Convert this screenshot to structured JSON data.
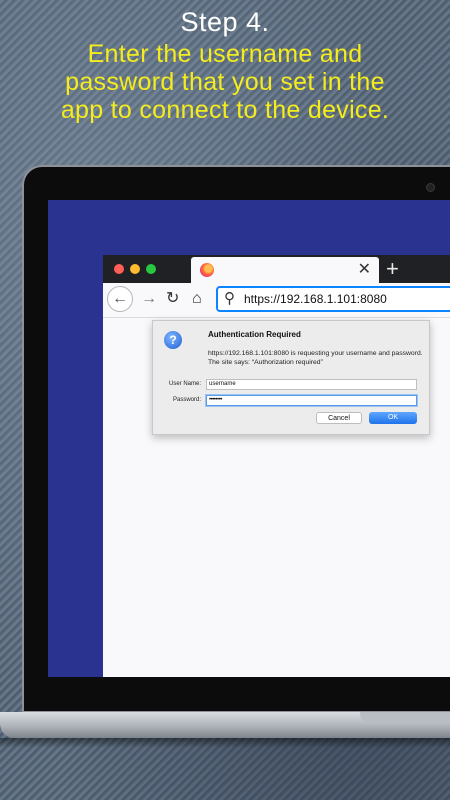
{
  "header": {
    "step": "Step 4.",
    "instruction_line1": "Enter the username and",
    "instruction_line2": "password that you set in the",
    "instruction_line3": "app to connect to the device."
  },
  "colors": {
    "instruction": "#f4ec1c",
    "screen_bg": "#2a3490",
    "ok_button": "#1f73ea"
  },
  "browser": {
    "tab": {
      "icon": "firefox-icon",
      "close": "✕"
    },
    "new_tab": "+",
    "nav": {
      "back": "←",
      "forward": "→",
      "reload": "↻",
      "home": "⌂"
    },
    "url": "https://192.168.1.101:8080"
  },
  "dialog": {
    "icon": "question-icon",
    "icon_glyph": "?",
    "title": "Authentication Required",
    "message": "https://192.168.1.101:8080 is requesting your username and password. The site says: “Authorization required”",
    "username_label": "User Name:",
    "username_value": "username",
    "password_label": "Password:",
    "password_value": "••••••••",
    "cancel_label": "Cancel",
    "ok_label": "OK"
  }
}
